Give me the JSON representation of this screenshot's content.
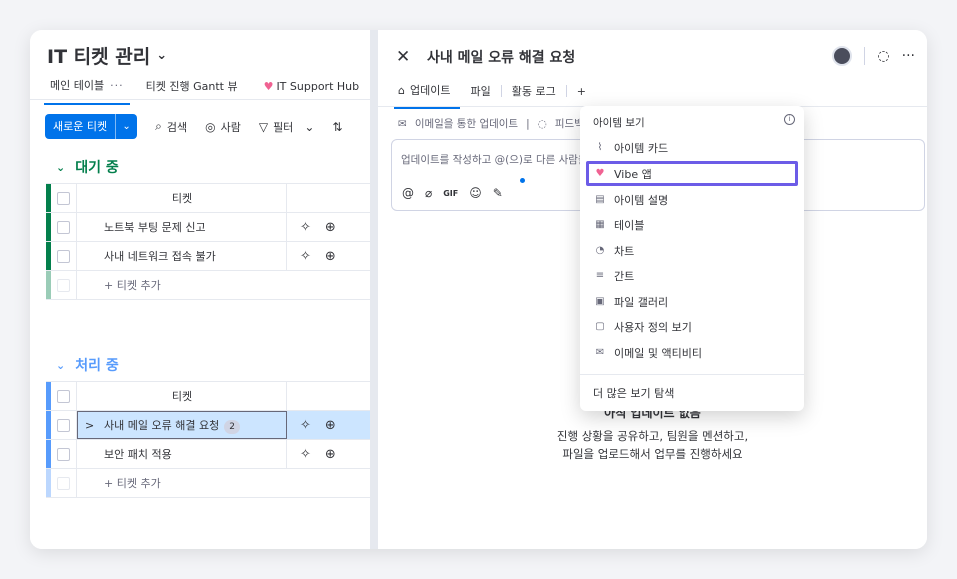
{
  "board": {
    "title": "IT 티켓 관리",
    "tabs": [
      {
        "label": "메인 테이블"
      },
      {
        "label": "티켓 진행 Gantt 뷰"
      },
      {
        "label": "IT Support Hub"
      }
    ],
    "toolbar": {
      "new_item": "새로운 티켓",
      "search": "검색",
      "person": "사람",
      "filter": "필터"
    },
    "groups": [
      {
        "title": "대기 중",
        "color": "#037f4c",
        "column": "티켓",
        "items": [
          "노트북 부팅 문제 신고",
          "사내 네트워크 접속 불가"
        ],
        "add": "+ 티켓 추가"
      },
      {
        "title": "처리 중",
        "color": "#579bfc",
        "column": "티켓",
        "items": [
          "사내 메일 오류 해결 요청",
          "보안 패치 적용"
        ],
        "updates_count": "2",
        "add": "+ 티켓 추가"
      }
    ]
  },
  "panel": {
    "title": "사내 메일 오류 해결 요청",
    "tabs": [
      {
        "label": "업데이트"
      },
      {
        "label": "파일"
      },
      {
        "label": "활동 로그"
      }
    ],
    "subtabs": [
      "이메일을 통한 업데이트",
      "피드백"
    ],
    "update_placeholder": "업데이트를 작성하고 @(으)로 다른 사람을",
    "gif": "GIF",
    "empty_title": "아직 업데이트 없음",
    "empty_desc_1": "진행 상황을 공유하고, 팀원을 멘션하고,",
    "empty_desc_2": "파일을 업로드해서 업무를 진행하세요"
  },
  "menu": {
    "header": "아이템 보기",
    "items": [
      {
        "label": "아이템 카드",
        "icon": "card-icon"
      },
      {
        "label": "Vibe 앱",
        "icon": "heart-icon"
      },
      {
        "label": "아이템 설명",
        "icon": "doc-icon"
      },
      {
        "label": "테이블",
        "icon": "table-icon"
      },
      {
        "label": "차트",
        "icon": "chart-icon"
      },
      {
        "label": "간트",
        "icon": "gantt-icon"
      },
      {
        "label": "파일 갤러리",
        "icon": "gallery-icon"
      },
      {
        "label": "사용자 정의 보기",
        "icon": "custom-icon"
      },
      {
        "label": "이메일 및 액티비티",
        "icon": "email-icon"
      }
    ],
    "more": "더 많은 보기 탐색"
  }
}
